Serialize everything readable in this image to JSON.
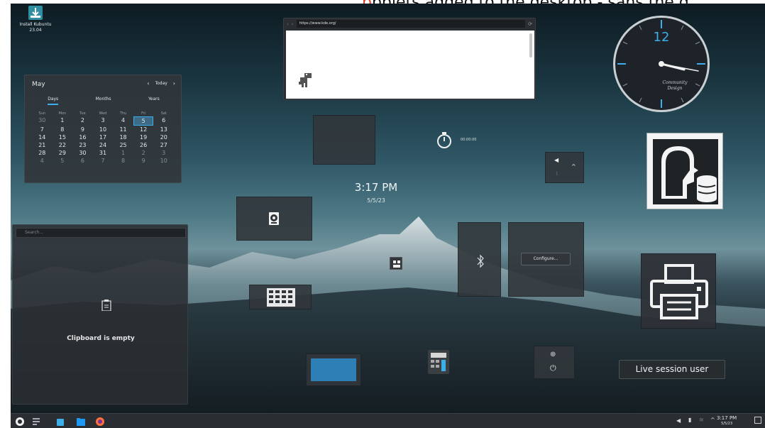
{
  "header_fragment": {
    "part_red": "p",
    "rest": "pplets added to the desktop - sans the g"
  },
  "desktop_icon": {
    "label": "Install Kubuntu",
    "sublabel": "23.04"
  },
  "calendar": {
    "month": "May",
    "today_label": "Today",
    "tabs": [
      "Days",
      "Months",
      "Years"
    ],
    "weekdays": [
      "Sun",
      "Mon",
      "Tue",
      "Wed",
      "Thu",
      "Fri",
      "Sat"
    ],
    "weeks": [
      [
        "30",
        "1",
        "2",
        "3",
        "4",
        "5",
        "6"
      ],
      [
        "7",
        "8",
        "9",
        "10",
        "11",
        "12",
        "13"
      ],
      [
        "14",
        "15",
        "16",
        "17",
        "18",
        "19",
        "20"
      ],
      [
        "21",
        "22",
        "23",
        "24",
        "25",
        "26",
        "27"
      ],
      [
        "28",
        "29",
        "30",
        "31",
        "1",
        "2",
        "3"
      ],
      [
        "4",
        "5",
        "6",
        "7",
        "8",
        "9",
        "10"
      ]
    ],
    "selected_day": "5"
  },
  "browser": {
    "url": "https://www.kde.org/"
  },
  "analog_clock": {
    "hour_label": "12",
    "brand_line1": "Community",
    "brand_line2": "Design",
    "time": "3:17"
  },
  "stopwatch": {
    "time": "00:00:00"
  },
  "digital_clock": {
    "time": "3:17 PM",
    "date": "5/5/23"
  },
  "network_applet": {
    "configure_label": "Configure..."
  },
  "clipboard": {
    "search_placeholder": "Search...",
    "empty_text": "Clipboard is empty"
  },
  "live_session": {
    "label": "Live session user"
  },
  "taskbar": {
    "icons": [
      "app-launcher-icon",
      "task-manager-icon",
      "discover-icon",
      "dolphin-icon",
      "firefox-icon"
    ],
    "tray_time": "3:17 PM",
    "tray_date": "5/5/23"
  },
  "colors": {
    "accent": "#3daee9",
    "panel": "#31363b",
    "taskbar": "#2a2e32"
  }
}
